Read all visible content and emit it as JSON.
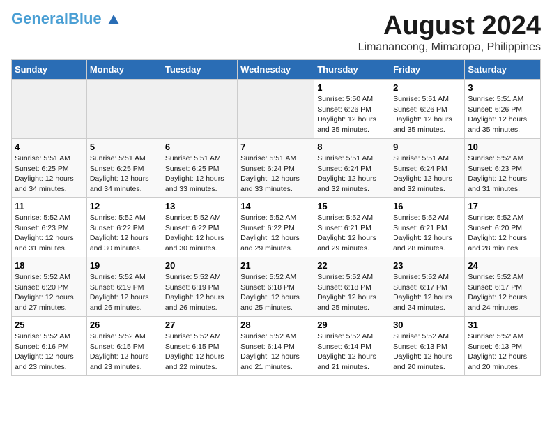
{
  "header": {
    "logo_general": "General",
    "logo_blue": "Blue",
    "main_title": "August 2024",
    "subtitle": "Limanancong, Mimaropa, Philippines"
  },
  "days_of_week": [
    "Sunday",
    "Monday",
    "Tuesday",
    "Wednesday",
    "Thursday",
    "Friday",
    "Saturday"
  ],
  "weeks": [
    [
      {
        "day": "",
        "info": ""
      },
      {
        "day": "",
        "info": ""
      },
      {
        "day": "",
        "info": ""
      },
      {
        "day": "",
        "info": ""
      },
      {
        "day": "1",
        "info": "Sunrise: 5:50 AM\nSunset: 6:26 PM\nDaylight: 12 hours\nand 35 minutes."
      },
      {
        "day": "2",
        "info": "Sunrise: 5:51 AM\nSunset: 6:26 PM\nDaylight: 12 hours\nand 35 minutes."
      },
      {
        "day": "3",
        "info": "Sunrise: 5:51 AM\nSunset: 6:26 PM\nDaylight: 12 hours\nand 35 minutes."
      }
    ],
    [
      {
        "day": "4",
        "info": "Sunrise: 5:51 AM\nSunset: 6:25 PM\nDaylight: 12 hours\nand 34 minutes."
      },
      {
        "day": "5",
        "info": "Sunrise: 5:51 AM\nSunset: 6:25 PM\nDaylight: 12 hours\nand 34 minutes."
      },
      {
        "day": "6",
        "info": "Sunrise: 5:51 AM\nSunset: 6:25 PM\nDaylight: 12 hours\nand 33 minutes."
      },
      {
        "day": "7",
        "info": "Sunrise: 5:51 AM\nSunset: 6:24 PM\nDaylight: 12 hours\nand 33 minutes."
      },
      {
        "day": "8",
        "info": "Sunrise: 5:51 AM\nSunset: 6:24 PM\nDaylight: 12 hours\nand 32 minutes."
      },
      {
        "day": "9",
        "info": "Sunrise: 5:51 AM\nSunset: 6:24 PM\nDaylight: 12 hours\nand 32 minutes."
      },
      {
        "day": "10",
        "info": "Sunrise: 5:52 AM\nSunset: 6:23 PM\nDaylight: 12 hours\nand 31 minutes."
      }
    ],
    [
      {
        "day": "11",
        "info": "Sunrise: 5:52 AM\nSunset: 6:23 PM\nDaylight: 12 hours\nand 31 minutes."
      },
      {
        "day": "12",
        "info": "Sunrise: 5:52 AM\nSunset: 6:22 PM\nDaylight: 12 hours\nand 30 minutes."
      },
      {
        "day": "13",
        "info": "Sunrise: 5:52 AM\nSunset: 6:22 PM\nDaylight: 12 hours\nand 30 minutes."
      },
      {
        "day": "14",
        "info": "Sunrise: 5:52 AM\nSunset: 6:22 PM\nDaylight: 12 hours\nand 29 minutes."
      },
      {
        "day": "15",
        "info": "Sunrise: 5:52 AM\nSunset: 6:21 PM\nDaylight: 12 hours\nand 29 minutes."
      },
      {
        "day": "16",
        "info": "Sunrise: 5:52 AM\nSunset: 6:21 PM\nDaylight: 12 hours\nand 28 minutes."
      },
      {
        "day": "17",
        "info": "Sunrise: 5:52 AM\nSunset: 6:20 PM\nDaylight: 12 hours\nand 28 minutes."
      }
    ],
    [
      {
        "day": "18",
        "info": "Sunrise: 5:52 AM\nSunset: 6:20 PM\nDaylight: 12 hours\nand 27 minutes."
      },
      {
        "day": "19",
        "info": "Sunrise: 5:52 AM\nSunset: 6:19 PM\nDaylight: 12 hours\nand 26 minutes."
      },
      {
        "day": "20",
        "info": "Sunrise: 5:52 AM\nSunset: 6:19 PM\nDaylight: 12 hours\nand 26 minutes."
      },
      {
        "day": "21",
        "info": "Sunrise: 5:52 AM\nSunset: 6:18 PM\nDaylight: 12 hours\nand 25 minutes."
      },
      {
        "day": "22",
        "info": "Sunrise: 5:52 AM\nSunset: 6:18 PM\nDaylight: 12 hours\nand 25 minutes."
      },
      {
        "day": "23",
        "info": "Sunrise: 5:52 AM\nSunset: 6:17 PM\nDaylight: 12 hours\nand 24 minutes."
      },
      {
        "day": "24",
        "info": "Sunrise: 5:52 AM\nSunset: 6:17 PM\nDaylight: 12 hours\nand 24 minutes."
      }
    ],
    [
      {
        "day": "25",
        "info": "Sunrise: 5:52 AM\nSunset: 6:16 PM\nDaylight: 12 hours\nand 23 minutes."
      },
      {
        "day": "26",
        "info": "Sunrise: 5:52 AM\nSunset: 6:15 PM\nDaylight: 12 hours\nand 23 minutes."
      },
      {
        "day": "27",
        "info": "Sunrise: 5:52 AM\nSunset: 6:15 PM\nDaylight: 12 hours\nand 22 minutes."
      },
      {
        "day": "28",
        "info": "Sunrise: 5:52 AM\nSunset: 6:14 PM\nDaylight: 12 hours\nand 21 minutes."
      },
      {
        "day": "29",
        "info": "Sunrise: 5:52 AM\nSunset: 6:14 PM\nDaylight: 12 hours\nand 21 minutes."
      },
      {
        "day": "30",
        "info": "Sunrise: 5:52 AM\nSunset: 6:13 PM\nDaylight: 12 hours\nand 20 minutes."
      },
      {
        "day": "31",
        "info": "Sunrise: 5:52 AM\nSunset: 6:13 PM\nDaylight: 12 hours\nand 20 minutes."
      }
    ]
  ]
}
